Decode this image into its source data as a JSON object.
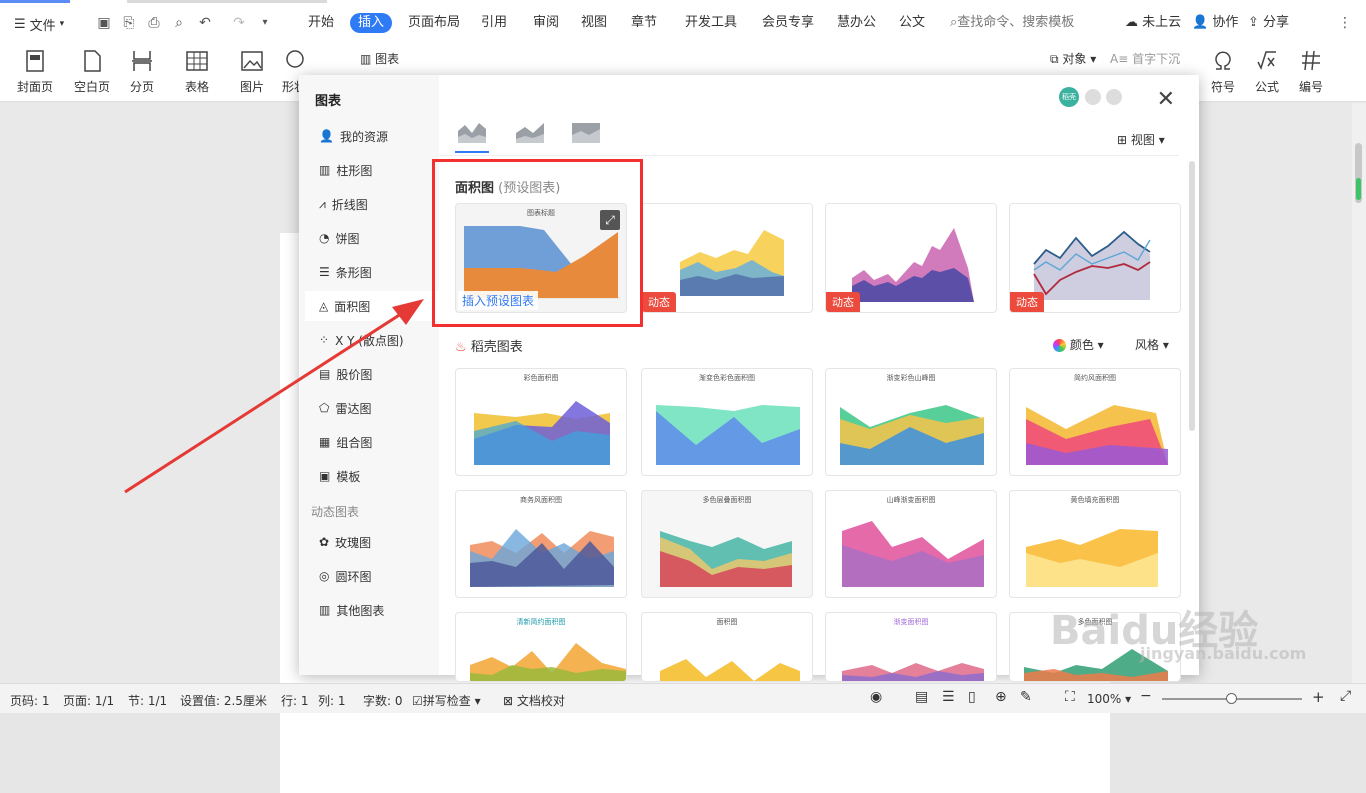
{
  "topbar": {
    "file_menu": "文件",
    "tabs": [
      "开始",
      "插入",
      "页面布局",
      "引用",
      "审阅",
      "视图",
      "章节",
      "开发工具",
      "会员专享",
      "慧办公",
      "公文"
    ],
    "active_tab": "插入",
    "search_placeholder": "查找命令、搜索模板",
    "cloud": "未上云",
    "collab": "协作",
    "share": "分享"
  },
  "ribbon": {
    "items": [
      "封面页",
      "空白页",
      "分页",
      "表格",
      "图片",
      "形状",
      "图表",
      "对象",
      "首字下沉",
      "符号",
      "公式",
      "编号"
    ]
  },
  "dialog": {
    "title": "图表",
    "sidebar": [
      "我的资源",
      "柱形图",
      "折线图",
      "饼图",
      "条形图",
      "面积图",
      "X Y (散点图)",
      "股价图",
      "雷达图",
      "组合图",
      "模板"
    ],
    "active_item": "面积图",
    "dynamic_section": "动态图表",
    "dynamic_items": [
      "玫瑰图",
      "圆环图",
      "其他图表"
    ],
    "view_label": "视图",
    "preset_title": "面积图",
    "preset_sub": "(预设图表)",
    "insert_preset": "插入预设图表",
    "dynamic_tag": "动态",
    "daoke_title": "稻壳图表",
    "color_label": "颜色",
    "style_label": "风格",
    "grid_titles": [
      "彩色面积图",
      "渐变色彩色面积图",
      "渐变彩色山峰图",
      "简约风面积图",
      "商务风面积图",
      "多色层叠面积图",
      "山峰渐变面积图",
      "黄色填充面积图",
      "清新简约面积图",
      "面积图",
      "渐变面积图",
      "多色面积图"
    ],
    "grid_subtitle": "图表标题"
  },
  "status": {
    "page_num": "页码: 1",
    "pages": "页面: 1/1",
    "section": "节: 1/1",
    "setting": "设置值: 2.5厘米",
    "row": "行: 1",
    "col": "列: 1",
    "words": "字数: 0",
    "spell": "拼写检查",
    "proof": "文档校对",
    "zoom": "100%"
  },
  "watermark": {
    "main": "Baidu经验",
    "url": "jingyan.baidu.com"
  },
  "colors": {
    "accent": "#2f7bf5",
    "dynamic_tag": "#ec4a3c",
    "highlight_box": "#f23030",
    "arrow": "#e53935"
  }
}
